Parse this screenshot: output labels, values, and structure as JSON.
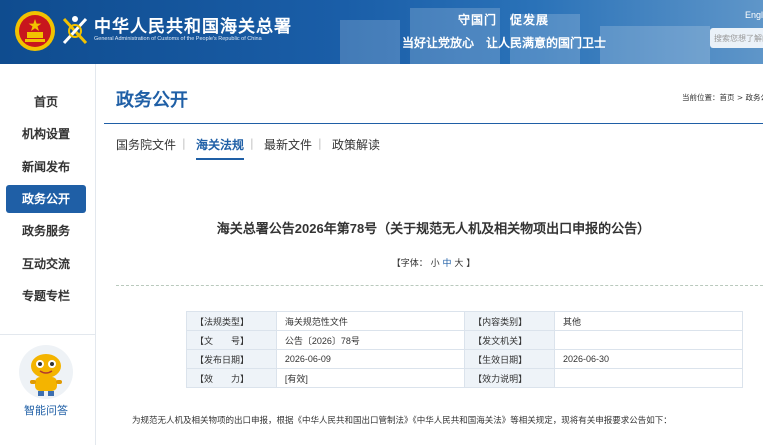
{
  "header": {
    "org_name_cn": "中华人民共和国海关总署",
    "org_name_en": "General Administration of Customs of the People's Republic of China",
    "slogan_line1": "守国门　促发展",
    "slogan_line2": "当好让党放心　让人民满意的国门卫士",
    "language_link": "Engl",
    "search_placeholder": "搜索您想了解的"
  },
  "sidebar": {
    "items": [
      {
        "label": "首页"
      },
      {
        "label": "机构设置"
      },
      {
        "label": "新闻发布"
      },
      {
        "label": "政务公开",
        "active": true
      },
      {
        "label": "政务服务"
      },
      {
        "label": "互动交流"
      },
      {
        "label": "专题专栏"
      }
    ],
    "assistant_label": "智能问答"
  },
  "main": {
    "page_title": "政务公开",
    "breadcrumb": "当前位置：首页 > 政务公",
    "tabs": [
      {
        "label": "国务院文件"
      },
      {
        "label": "海关法规",
        "active": true
      },
      {
        "label": "最新文件"
      },
      {
        "label": "政策解读"
      }
    ],
    "doc_title": "海关总署公告2026年第78号（关于规范无人机及相关物项出口申报的公告）",
    "font_size": {
      "prefix": "【字体：",
      "small": "小",
      "medium": "中",
      "large": "大",
      "suffix": "】"
    },
    "meta": [
      {
        "k1": "【法规类型】",
        "v1": "海关规范性文件",
        "k2": "【内容类别】",
        "v2": "其他"
      },
      {
        "k1": "【文　　号】",
        "v1": "公告〔2026〕78号",
        "k2": "【发文机关】",
        "v2": ""
      },
      {
        "k1": "【发布日期】",
        "v1": "2026-06-09",
        "k2": "【生效日期】",
        "v2": "2026-06-30"
      },
      {
        "k1": "【效　　力】",
        "v1": "[有效]",
        "k2": "【效力说明】",
        "v2": ""
      }
    ],
    "body_first_line": "为规范无人机及相关物项的出口申报，根据《中华人民共和国出口管制法》《中华人民共和国海关法》等相关规定，现将有关申报要求公告如下："
  },
  "colors": {
    "primary_blue": "#1f5fa6",
    "header_gradient_start": "#0f4c8f",
    "header_gradient_end": "#5f96c9",
    "emblem_red": "#c8161d",
    "emblem_gold": "#f2c200"
  },
  "icons": [
    "national-emblem-icon",
    "customs-logo-icon",
    "assistant-mascot-icon"
  ]
}
